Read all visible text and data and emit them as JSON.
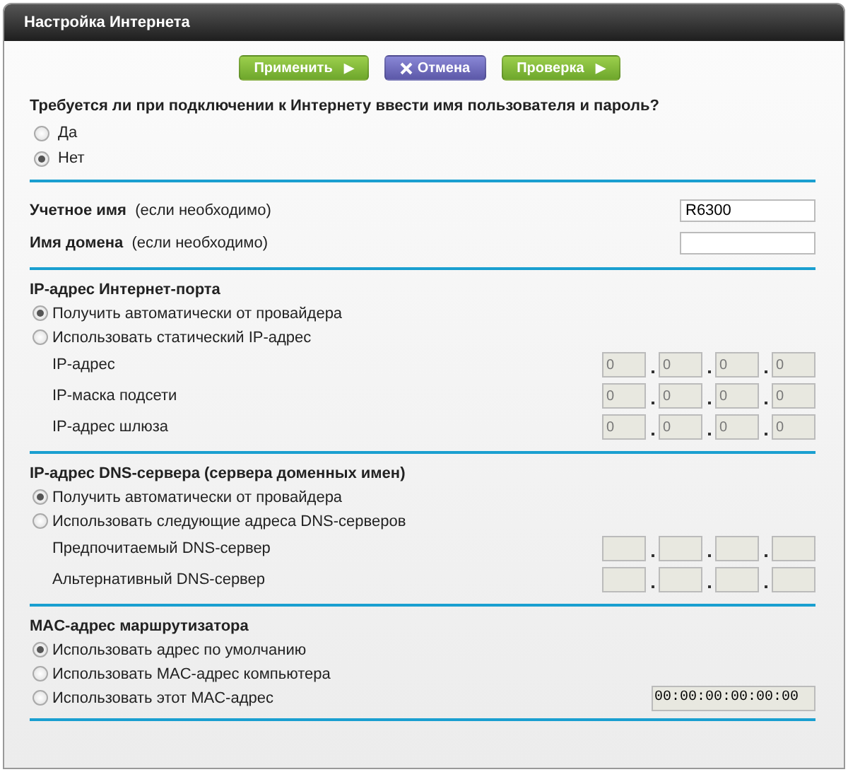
{
  "window": {
    "title": "Настройка Интернета"
  },
  "buttons": [
    {
      "label": "Применить",
      "kind": "apply",
      "icon": "▶"
    },
    {
      "label": "Отмена",
      "kind": "cancel"
    },
    {
      "label": "Проверка",
      "kind": "test",
      "icon": "▶"
    }
  ],
  "login_question": {
    "text": "Требуется ли при подключении к Интернету ввести имя пользователя и пароль?",
    "options": [
      {
        "label": "Да",
        "selected": false
      },
      {
        "label": "Нет",
        "selected": true
      }
    ]
  },
  "account": {
    "fields": [
      {
        "label": "Учетное имя",
        "hint": "(если необходимо)",
        "value": "R6300"
      },
      {
        "label": "Имя домена",
        "hint": "(если необходимо)"
      }
    ]
  },
  "ip_section": {
    "title": "IP-адрес Интернет-порта",
    "options": [
      {
        "label": "Получить автоматически от провайдера",
        "selected": true
      },
      {
        "label": "Использовать статический IP-адрес",
        "selected": false
      }
    ],
    "fields": [
      {
        "label": "IP-адрес",
        "octets": [
          "0",
          "0",
          "0",
          "0"
        ],
        "disabled": true
      },
      {
        "label": "IP-маска подсети",
        "octets": [
          "0",
          "0",
          "0",
          "0"
        ],
        "disabled": true
      },
      {
        "label": "IP-адрес шлюза",
        "octets": [
          "0",
          "0",
          "0",
          "0"
        ],
        "disabled": true
      }
    ]
  },
  "dns_section": {
    "title": "IP-адрес DNS-сервера (сервера доменных имен)",
    "options": [
      {
        "label": "Получить автоматически от провайдера",
        "selected": true
      },
      {
        "label": "Использовать следующие адреса DNS-серверов",
        "selected": false
      }
    ],
    "fields": [
      {
        "label": "Предпочитаемый DNS-сервер",
        "disabled": true
      },
      {
        "label": "Альтернативный DNS-сервер",
        "disabled": true
      }
    ]
  },
  "mac_section": {
    "title": "MAC-адрес маршрутизатора",
    "options": [
      {
        "label": "Использовать адрес по умолчанию",
        "selected": true
      },
      {
        "label": "Использовать MAC-адрес компьютера",
        "selected": false
      },
      {
        "label": "Использовать этот MAC-адрес",
        "selected": false,
        "value": "00:00:00:00:00:00",
        "disabled": true
      }
    ]
  }
}
